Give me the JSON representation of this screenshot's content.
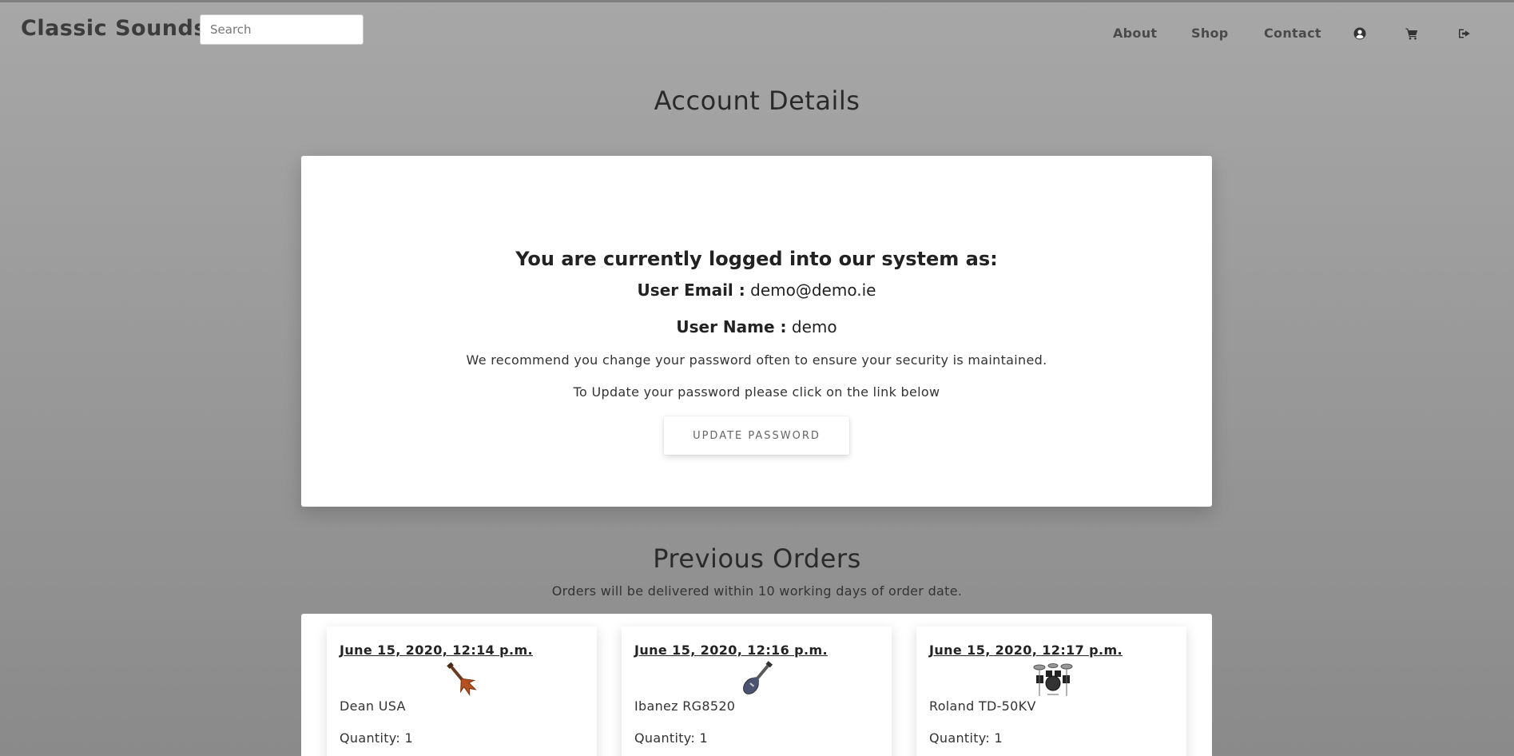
{
  "header": {
    "brand": "Classic Sounds",
    "search_placeholder": "Search",
    "nav": [
      {
        "label": "About"
      },
      {
        "label": "Shop"
      },
      {
        "label": "Contact"
      }
    ],
    "icons": [
      "user-circle-icon",
      "cart-icon",
      "sign-out-icon"
    ]
  },
  "account": {
    "title": "Account Details",
    "logged_in_heading": "You are currently logged into our system as:",
    "email_label": "User Email :",
    "email_value": "demo@demo.ie",
    "username_label": "User Name :",
    "username_value": "demo",
    "recommend_text": "We recommend you change your password often to ensure your security is maintained.",
    "update_text": "To Update your password please click on the link below",
    "update_button": "UPDATE PASSWORD"
  },
  "orders": {
    "title": "Previous Orders",
    "subtitle": "Orders will be delivered within 10 working days of order date.",
    "items": [
      {
        "date": "June 15, 2020, 12:14 p.m.",
        "product": "Dean USA",
        "quantity": "Quantity: 1",
        "image_icon": "guitar-icon"
      },
      {
        "date": "June 15, 2020, 12:16 p.m.",
        "product": "Ibanez RG8520",
        "quantity": "Quantity: 1",
        "image_icon": "guitar-icon"
      },
      {
        "date": "June 15, 2020, 12:17 p.m.",
        "product": "Roland TD-50KV",
        "quantity": "Quantity: 1",
        "image_icon": "drum-kit-icon"
      }
    ]
  },
  "colors": {
    "background": "#9e9e9e",
    "card": "#ffffff",
    "text": "#222222"
  }
}
